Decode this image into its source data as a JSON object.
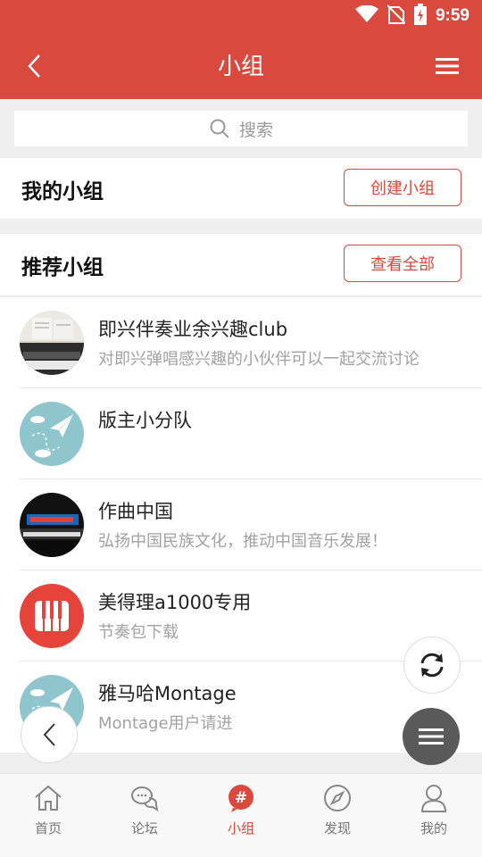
{
  "status_bar": {
    "time": "9:59"
  },
  "header": {
    "title": "小组"
  },
  "search": {
    "placeholder": "搜索"
  },
  "my_groups": {
    "title": "我的小组",
    "create_button": "创建小组"
  },
  "recommended": {
    "title": "推荐小组",
    "view_all_button": "查看全部"
  },
  "groups": [
    {
      "name": "即兴伴奏业余兴趣club",
      "desc": "对即兴弹唱感兴趣的小伙伴可以一起交流讨论",
      "avatar": "piano-photo"
    },
    {
      "name": "版主小分队",
      "desc": "",
      "avatar": "paper-plane"
    },
    {
      "name": "作曲中国",
      "desc": "弘扬中国民族文化，推动中国音乐发展！",
      "avatar": "keyboard-stage"
    },
    {
      "name": "美得理a1000专用",
      "desc": "节奏包下载",
      "avatar": "piano-keys-logo"
    },
    {
      "name": "雅马哈Montage",
      "desc": "Montage用户请进",
      "avatar": "paper-plane"
    }
  ],
  "tabs": [
    {
      "label": "首页",
      "icon": "home-icon"
    },
    {
      "label": "论坛",
      "icon": "chat-icon"
    },
    {
      "label": "小组",
      "icon": "hashtag-icon",
      "active": true
    },
    {
      "label": "发现",
      "icon": "compass-icon"
    },
    {
      "label": "我的",
      "icon": "user-icon"
    }
  ],
  "colors": {
    "brand": "#d9493d",
    "fab_dark": "#5a5a5a"
  }
}
